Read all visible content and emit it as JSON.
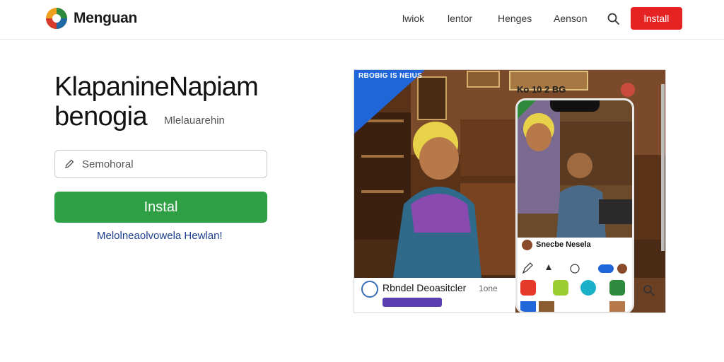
{
  "header": {
    "brand": "Menguan",
    "nav": [
      "lwiok",
      "lentor",
      "Henges",
      "Aenson"
    ],
    "install_label": "lnstall"
  },
  "hero": {
    "title_line1": "KlapanineNapiam",
    "title_line2": "benogia",
    "tagline": "Mlelauarehin",
    "search_placeholder": "Semohoral",
    "install_label": "Instal",
    "link_text": "Melolneaolvowela Hewlan!"
  },
  "preview": {
    "corner_label": "RBOBIG IS NEIUS",
    "status_left": "Ko 10 2 BG",
    "app_title": "Rbndel Deoasitcler",
    "app_meta": "1one",
    "phone_name": "Snecbe Nesela"
  },
  "colors": {
    "accent_red": "#e52323",
    "accent_green": "#2ea043",
    "link_blue": "#1b3e8f"
  },
  "icons": [
    "logo-icon",
    "search-icon",
    "pencil-icon"
  ]
}
